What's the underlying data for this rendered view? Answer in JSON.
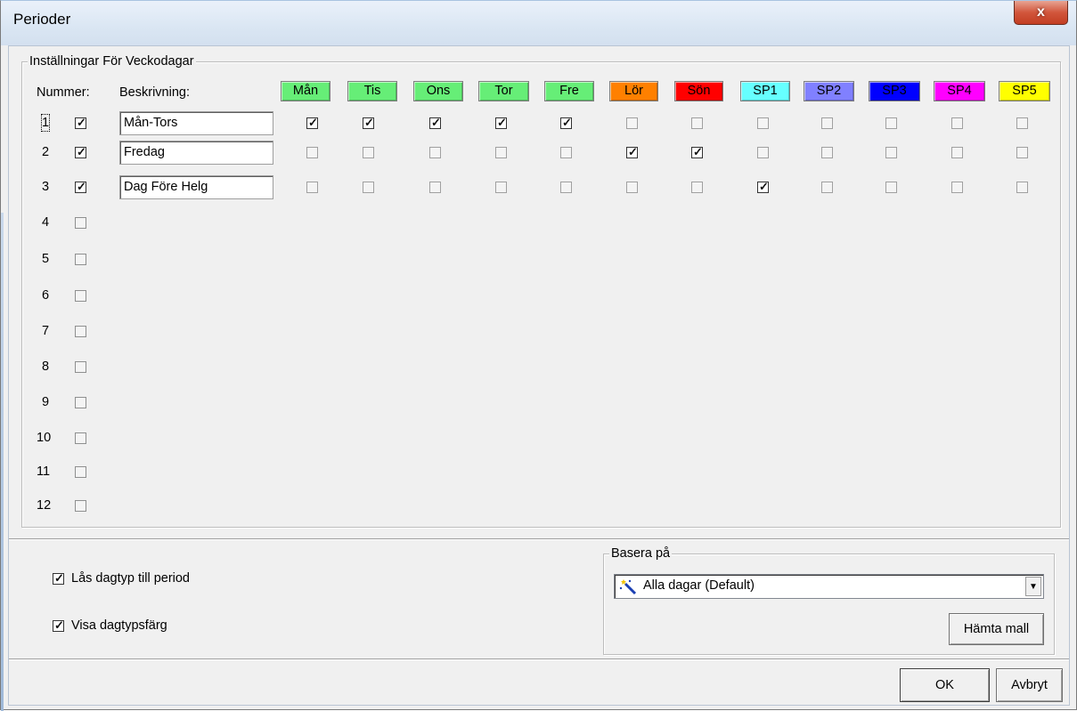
{
  "window": {
    "title": "Perioder",
    "close_label": "x"
  },
  "weekday_group": {
    "label": "Inställningar För Veckodagar",
    "number_header": "Nummer:",
    "description_header": "Beskrivning:",
    "days": [
      {
        "label": "Mån",
        "color": "#66ee77"
      },
      {
        "label": "Tis",
        "color": "#66ee77"
      },
      {
        "label": "Ons",
        "color": "#66ee77"
      },
      {
        "label": "Tor",
        "color": "#66ee77"
      },
      {
        "label": "Fre",
        "color": "#66ee77"
      },
      {
        "label": "Lör",
        "color": "#ff8000"
      },
      {
        "label": "Sön",
        "color": "#ff0000"
      },
      {
        "label": "SP1",
        "color": "#66ffff"
      },
      {
        "label": "SP2",
        "color": "#8080ff"
      },
      {
        "label": "SP3",
        "color": "#0000ff"
      },
      {
        "label": "SP4",
        "color": "#ff00ff"
      },
      {
        "label": "SP5",
        "color": "#ffff00"
      }
    ],
    "periods": [
      {
        "number": "1",
        "enabled": true,
        "description": "Mån-Tors",
        "days": [
          true,
          true,
          true,
          true,
          true,
          false,
          false,
          false,
          false,
          false,
          false,
          false
        ]
      },
      {
        "number": "2",
        "enabled": true,
        "description": "Fredag",
        "days": [
          false,
          false,
          false,
          false,
          false,
          true,
          true,
          false,
          false,
          false,
          false,
          false
        ]
      },
      {
        "number": "3",
        "enabled": true,
        "description": "Dag Före Helg",
        "days": [
          false,
          false,
          false,
          false,
          false,
          false,
          false,
          true,
          false,
          false,
          false,
          false
        ]
      },
      {
        "number": "4",
        "enabled": false
      },
      {
        "number": "5",
        "enabled": false
      },
      {
        "number": "6",
        "enabled": false
      },
      {
        "number": "7",
        "enabled": false
      },
      {
        "number": "8",
        "enabled": false
      },
      {
        "number": "9",
        "enabled": false
      },
      {
        "number": "10",
        "enabled": false
      },
      {
        "number": "11",
        "enabled": false
      },
      {
        "number": "12",
        "enabled": false
      }
    ]
  },
  "options": {
    "lock_daytype_label": "Lås dagtyp till period",
    "lock_daytype_checked": true,
    "show_color_label": "Visa dagtypsfärg",
    "show_color_checked": true
  },
  "base_on": {
    "label": "Basera på",
    "selected": "Alla dagar (Default)",
    "fetch_button": "Hämta mall"
  },
  "footer": {
    "ok_label": "OK",
    "cancel_label": "Avbryt"
  }
}
